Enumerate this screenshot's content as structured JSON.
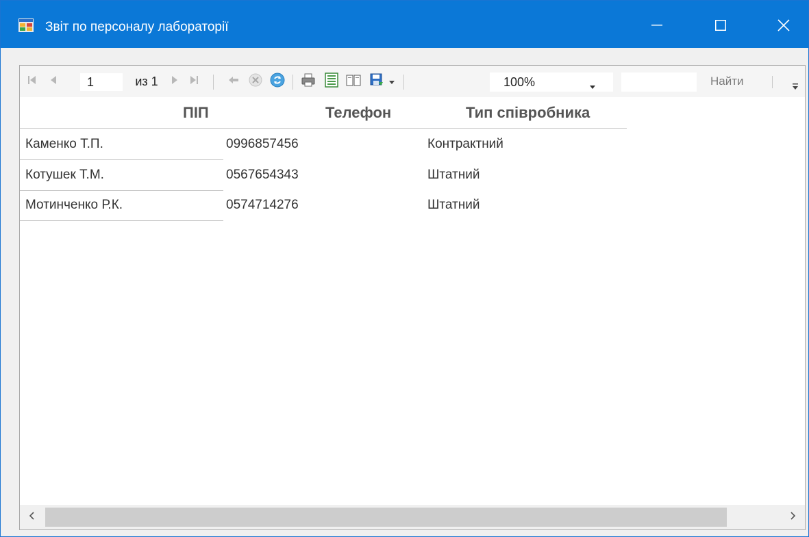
{
  "window": {
    "title": "Звіт по персоналу лабораторії",
    "icon": "report-app-icon",
    "controls": {
      "minimize_icon": "minimize-icon",
      "maximize_icon": "maximize-icon",
      "close_icon": "close-icon"
    },
    "accent_color": "#0b78d7"
  },
  "toolbar": {
    "page_current": "1",
    "page_of_label": "из 1",
    "zoom_value": "100%",
    "find_label": "Найти",
    "icons": [
      "first-page-icon",
      "previous-page-icon",
      "next-page-icon",
      "last-page-icon",
      "back-icon",
      "stop-icon",
      "refresh-icon",
      "print-icon",
      "print-layout-icon",
      "page-setup-icon",
      "export-icon",
      "dropdown-arrow-icon",
      "overflow-icon"
    ]
  },
  "report": {
    "headers": {
      "name": "ПІП",
      "phone": "Телефон",
      "type": "Тип співробника"
    },
    "rows": [
      {
        "name": "Каменко Т.П.",
        "phone": "0996857456",
        "type": "Контрактний"
      },
      {
        "name": "Котушек Т.М.",
        "phone": "0567654343",
        "type": "Штатний"
      },
      {
        "name": "Мотинченко Р.К.",
        "phone": "0574714276",
        "type": "Штатний"
      }
    ]
  },
  "scrollbar": {
    "left_icon": "scroll-left-icon",
    "right_icon": "scroll-right-icon"
  }
}
